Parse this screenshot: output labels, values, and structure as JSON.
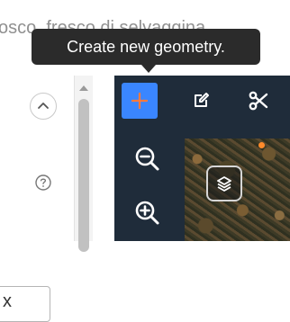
{
  "page_title_partial": "osco, fresco di selvaggina",
  "tooltip": {
    "text": "Create new geometry."
  },
  "left_panel": {
    "dropdown_value": "x"
  },
  "toolbar": {
    "tools": [
      {
        "name": "create-geometry",
        "icon": "plus-icon",
        "active": true
      },
      {
        "name": "edit-geometry",
        "icon": "edit-icon",
        "active": false
      },
      {
        "name": "cut-geometry",
        "icon": "scissors-icon",
        "active": false
      }
    ],
    "zoom": {
      "out_icon": "zoom-out-icon",
      "in_icon": "zoom-in-icon"
    },
    "layers_icon": "layers-icon"
  },
  "colors": {
    "accent": "#3a86ff",
    "plus": "#ff7a3d",
    "toolbar_bg": "#1f2c3a",
    "tooltip_bg": "#2b2b2b",
    "marker": "#ff8a2b"
  }
}
